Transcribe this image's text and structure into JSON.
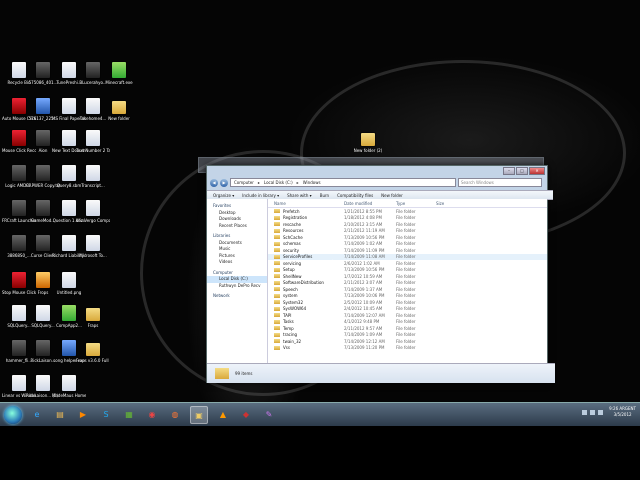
{
  "desktop_icons": [
    {
      "label": "Recycle Bin",
      "style": "doc"
    },
    {
      "label": "575086_401...",
      "style": "dark"
    },
    {
      "label": "TunePreshi...",
      "style": "doc"
    },
    {
      "label": "BLucerahyo...",
      "style": "dark"
    },
    {
      "label": "Minecraft.exe",
      "style": "green"
    },
    {
      "label": "Auto Mouse Clicker",
      "style": "red"
    },
    {
      "label": "576137_225...",
      "style": "blue"
    },
    {
      "label": "MS Final Paper.docx",
      "style": "doc"
    },
    {
      "label": "Takehome4...",
      "style": "doc"
    },
    {
      "label": "New folder",
      "style": "folder"
    },
    {
      "label": "Mouse Click Recorder",
      "style": "red"
    },
    {
      "label": "Aion",
      "style": "dark"
    },
    {
      "label": "New Text Document.txt",
      "style": "doc"
    },
    {
      "label": "Text Number 2 Take ho...",
      "style": "doc"
    },
    {
      "label": "Logic AMDB...",
      "style": "dark"
    },
    {
      "label": "CRPWER Copy.txt",
      "style": "dark"
    },
    {
      "label": "Query8.sbm",
      "style": "doc"
    },
    {
      "label": "Transcript...",
      "style": "doc"
    },
    {
      "label": "FRCraft Launcher",
      "style": "dark"
    },
    {
      "label": "GameMod...",
      "style": "dark"
    },
    {
      "label": "Question 1.docx",
      "style": "doc"
    },
    {
      "label": "Wiz Vergo Compani...",
      "style": "doc"
    },
    {
      "label": "38868S0_...",
      "style": "dark"
    },
    {
      "label": "Curse Client",
      "style": "dark"
    },
    {
      "label": "Richard Liability Re...",
      "style": "doc"
    },
    {
      "label": "Microsoft To...",
      "style": "doc"
    },
    {
      "label": "Stop Mouse Clicking",
      "style": "red"
    },
    {
      "label": "Frops",
      "style": "orange"
    },
    {
      "label": "Untitled.png",
      "style": "doc"
    },
    {
      "label": "SQLQuery...",
      "style": "doc"
    },
    {
      "label": "SQLQuery...",
      "style": "doc"
    },
    {
      "label": "CompApp2...",
      "style": "green"
    },
    {
      "label": "Fraps",
      "style": "folder"
    },
    {
      "label": "hammer_fli...",
      "style": "dark"
    },
    {
      "label": "RickLaison...",
      "style": "dark"
    },
    {
      "label": "song helper.exe",
      "style": "blue"
    },
    {
      "label": "Frops v3.6.0 Full Regist...",
      "style": "folder"
    },
    {
      "label": "Linear vs Windows b...",
      "style": "doc"
    },
    {
      "label": "RickLaison... (2).to.rdl",
      "style": "doc"
    },
    {
      "label": "MadeMaus Homework...",
      "style": "doc"
    }
  ],
  "floating_folder": {
    "label": "New folder (2)"
  },
  "window": {
    "address_root": "Computer",
    "address_drive": "Local Disk (C:)",
    "address_folder": "Windows",
    "search_placeholder": "Search Windows",
    "toolbar": [
      "Organize ▾",
      "Include in library ▾",
      "Share with ▾",
      "Burn",
      "Compatibility files",
      "New folder"
    ],
    "nav": {
      "favorites": "Favorites",
      "desktop": "Desktop",
      "downloads": "Downloads",
      "recent": "Recent Places",
      "libraries": "Libraries",
      "documents": "Documents",
      "music": "Music",
      "pictures": "Pictures",
      "videos": "Videos",
      "computer": "Computer",
      "local_disk": "Local Disk (C:)",
      "ruthwyn": "Ruthwyn DePro Recv",
      "network": "Network"
    },
    "columns": {
      "name": "Name",
      "date": "Date modified",
      "type": "Type",
      "size": "Size"
    },
    "files": [
      {
        "name": "Prefetch",
        "date": "1/21/2012 8:55 PM",
        "type": "File folder"
      },
      {
        "name": "Registration",
        "date": "1/18/2012 4:08 PM",
        "type": "File folder"
      },
      {
        "name": "rescache",
        "date": "2/10/2012 3:15 AM",
        "type": "File folder"
      },
      {
        "name": "Resources",
        "date": "2/11/2012 11:19 AM",
        "type": "File folder"
      },
      {
        "name": "SchCache",
        "date": "7/13/2009 10:56 PM",
        "type": "File folder"
      },
      {
        "name": "schemas",
        "date": "7/14/2009 1:02 AM",
        "type": "File folder"
      },
      {
        "name": "security",
        "date": "7/14/2009 11:09 PM",
        "type": "File folder"
      },
      {
        "name": "ServiceProfiles",
        "date": "7/14/2009 11:08 AM",
        "type": "File folder"
      },
      {
        "name": "servicing",
        "date": "2/6/2012 1:02 AM",
        "type": "File folder"
      },
      {
        "name": "Setup",
        "date": "7/13/2009 10:56 PM",
        "type": "File folder"
      },
      {
        "name": "ShellNew",
        "date": "1/7/2012 10:59 AM",
        "type": "File folder"
      },
      {
        "name": "SoftwareDistribution",
        "date": "2/11/2012 3:07 AM",
        "type": "File folder"
      },
      {
        "name": "Speech",
        "date": "7/14/2009 1:37 AM",
        "type": "File folder"
      },
      {
        "name": "system",
        "date": "7/13/2009 10:06 PM",
        "type": "File folder"
      },
      {
        "name": "System32",
        "date": "2/5/2012 10:09 AM",
        "type": "File folder"
      },
      {
        "name": "SysWOW64",
        "date": "2/4/2012 10:45 AM",
        "type": "File folder"
      },
      {
        "name": "TAPI",
        "date": "7/14/2009 12:07 AM",
        "type": "File folder"
      },
      {
        "name": "Tasks",
        "date": "4/1/2012 9:48 PM",
        "type": "File folder"
      },
      {
        "name": "Temp",
        "date": "2/11/2012 9:57 AM",
        "type": "File folder"
      },
      {
        "name": "tracing",
        "date": "7/14/2009 1:09 AM",
        "type": "File folder"
      },
      {
        "name": "twain_32",
        "date": "7/14/2009 12:12 AM",
        "type": "File folder"
      },
      {
        "name": "Vss",
        "date": "7/13/2009 11:20 PM",
        "type": "File folder"
      }
    ],
    "item_count": "99 items"
  },
  "taskbar": {
    "apps": [
      "ie",
      "folder",
      "media",
      "skype",
      "minecraft",
      "chrome",
      "firefox",
      "explorer",
      "vlc",
      "game",
      "paint"
    ],
    "clock_time": "9:26 ARGENT",
    "clock_date": "3/5/2012"
  }
}
